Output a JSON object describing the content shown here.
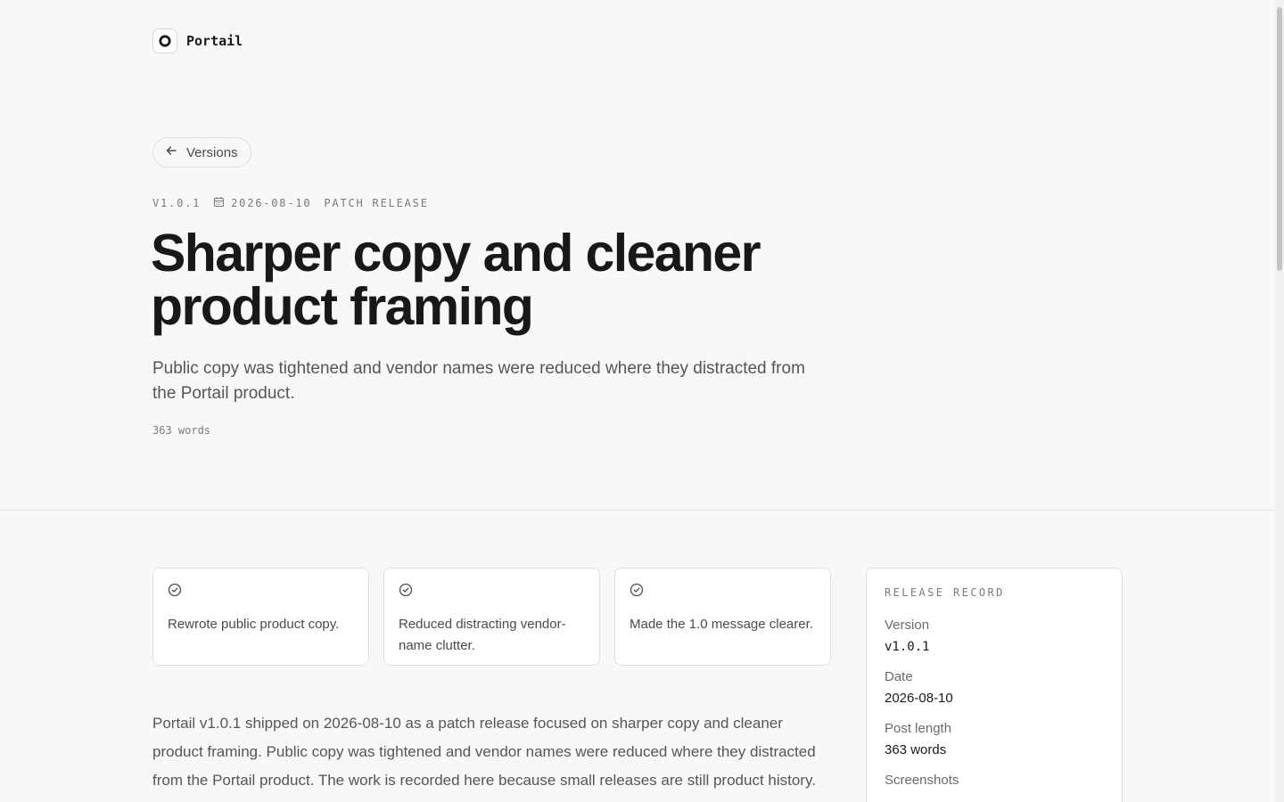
{
  "brand": {
    "name": "Portail"
  },
  "nav": {
    "back_label": "Versions"
  },
  "meta": {
    "version": "V1.0.1",
    "date": "2026-08-10",
    "release_type": "PATCH RELEASE"
  },
  "post": {
    "title": "Sharper copy and cleaner product framing",
    "subtitle": "Public copy was tightened and vendor names were reduced where they distracted from the Portail product.",
    "word_count": "363 words",
    "highlights": [
      {
        "text": "Rewrote public product copy."
      },
      {
        "text": "Reduced distracting vendor-name clutter."
      },
      {
        "text": "Made the 1.0 message clearer."
      }
    ],
    "body": "Portail v1.0.1 shipped on 2026-08-10 as a patch release focused on sharper copy and cleaner product framing. Public copy was tightened and vendor names were reduced where they distracted from the Portail product. The work is recorded here because small releases are still product history."
  },
  "record": {
    "heading": "RELEASE RECORD",
    "version_label": "Version",
    "version_value": "v1.0.1",
    "date_label": "Date",
    "date_value": "2026-08-10",
    "length_label": "Post length",
    "length_value": "363 words",
    "screenshots_label": "Screenshots"
  },
  "icons": {
    "logo": "portail-logo-icon",
    "back": "arrow-left-icon",
    "calendar": "calendar-icon",
    "check": "check-circle-icon"
  }
}
